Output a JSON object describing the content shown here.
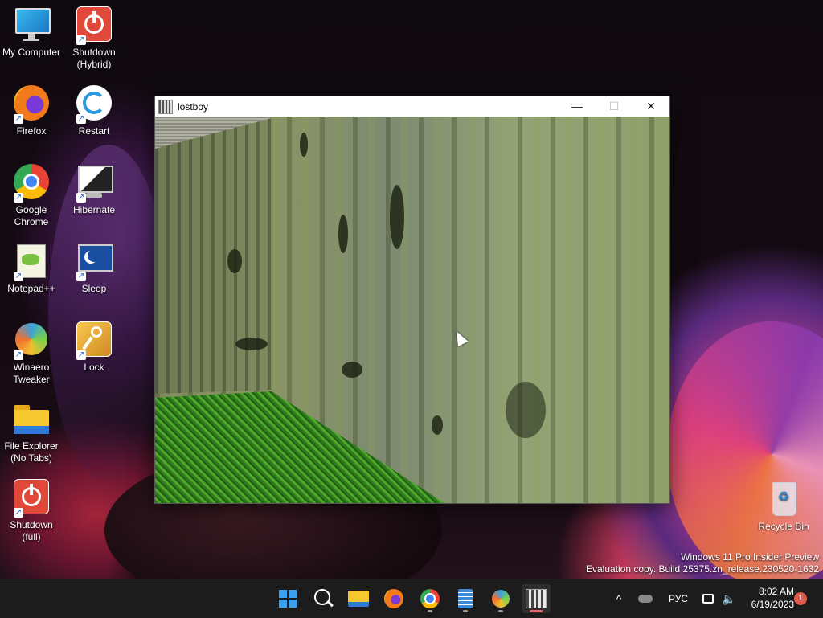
{
  "desktop": {
    "icons": [
      {
        "label": "My Computer",
        "icon": "monitor-icon"
      },
      {
        "label": "Shutdown (Hybrid)",
        "icon": "power-icon"
      },
      {
        "label": "Firefox",
        "icon": "firefox-icon"
      },
      {
        "label": "Restart",
        "icon": "restart-icon"
      },
      {
        "label": "Google Chrome",
        "icon": "chrome-icon"
      },
      {
        "label": "Hibernate",
        "icon": "hibernate-icon"
      },
      {
        "label": "Notepad++",
        "icon": "notepadpp-icon"
      },
      {
        "label": "Sleep",
        "icon": "sleep-icon"
      },
      {
        "label": "Winaero Tweaker",
        "icon": "winaero-icon"
      },
      {
        "label": "Lock",
        "icon": "key-icon"
      },
      {
        "label": "File Explorer (No Tabs)",
        "icon": "folder-icon"
      },
      {
        "label": "Shutdown (full)",
        "icon": "power-icon"
      },
      {
        "label": "Recycle Bin",
        "icon": "recycle-bin-icon"
      }
    ],
    "watermark_line1": "Windows 11 Pro Insider Preview",
    "watermark_line2": "Evaluation copy. Build 25375.zn_release.230520-1632"
  },
  "window": {
    "title": "lostboy",
    "minimize": "—",
    "maximize": "☐",
    "close": "✕"
  },
  "taskbar": {
    "apps": [
      "start-icon",
      "search-icon",
      "file-explorer-icon",
      "firefox-icon",
      "chrome-icon",
      "notepad-icon",
      "winaero-icon",
      "lostboy-icon"
    ],
    "tray": {
      "chevron": "^",
      "language": "РУС"
    },
    "time": "8:02 AM",
    "date": "6/19/2023",
    "notification_count": "1"
  }
}
